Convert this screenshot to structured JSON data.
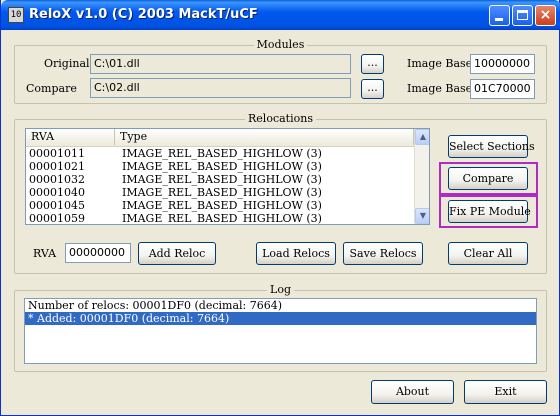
{
  "window": {
    "title": "ReloX v1.0 (C) 2003 MackT/uCF",
    "icon_text": "10"
  },
  "title_buttons": {
    "minimize": "minimize",
    "maximize": "maximize",
    "close": "×"
  },
  "modules": {
    "group_title": "Modules",
    "original_label": "Original",
    "original_value": "C:\\01.dll",
    "compare_label": "Compare",
    "compare_value": "C:\\02.dll",
    "browse_label": "...",
    "image_base_label": "Image Base",
    "original_image_base": "10000000",
    "compare_image_base": "01C70000"
  },
  "relocations": {
    "group_title": "Relocations",
    "columns": [
      "RVA",
      "Type"
    ],
    "rows": [
      {
        "rva": "00001011",
        "type": "IMAGE_REL_BASED_HIGHLOW (3)"
      },
      {
        "rva": "00001021",
        "type": "IMAGE_REL_BASED_HIGHLOW (3)"
      },
      {
        "rva": "00001032",
        "type": "IMAGE_REL_BASED_HIGHLOW (3)"
      },
      {
        "rva": "00001040",
        "type": "IMAGE_REL_BASED_HIGHLOW (3)"
      },
      {
        "rva": "00001045",
        "type": "IMAGE_REL_BASED_HIGHLOW (3)"
      },
      {
        "rva": "00001059",
        "type": "IMAGE_REL_BASED_HIGHLOW (3)"
      }
    ],
    "rva_label": "RVA",
    "rva_value": "00000000",
    "add_reloc": "Add Reloc",
    "load_relocs": "Load Relocs",
    "save_relocs": "Save Relocs",
    "select_sections": "Select Sections",
    "compare": "Compare",
    "fix_pe": "Fix PE Module",
    "clear_all": "Clear All"
  },
  "log": {
    "group_title": "Log",
    "lines": [
      {
        "text": "Number of relocs: 00001DF0 (decimal: 7664)",
        "selected": false
      },
      {
        "text": "* Added: 00001DF0 (decimal: 7664)",
        "selected": true
      }
    ]
  },
  "footer": {
    "about": "About",
    "exit": "Exit"
  },
  "colors": {
    "highlight_border": "#b02cc0",
    "selection": "#316ac5",
    "titlebar": "#0058ee"
  }
}
